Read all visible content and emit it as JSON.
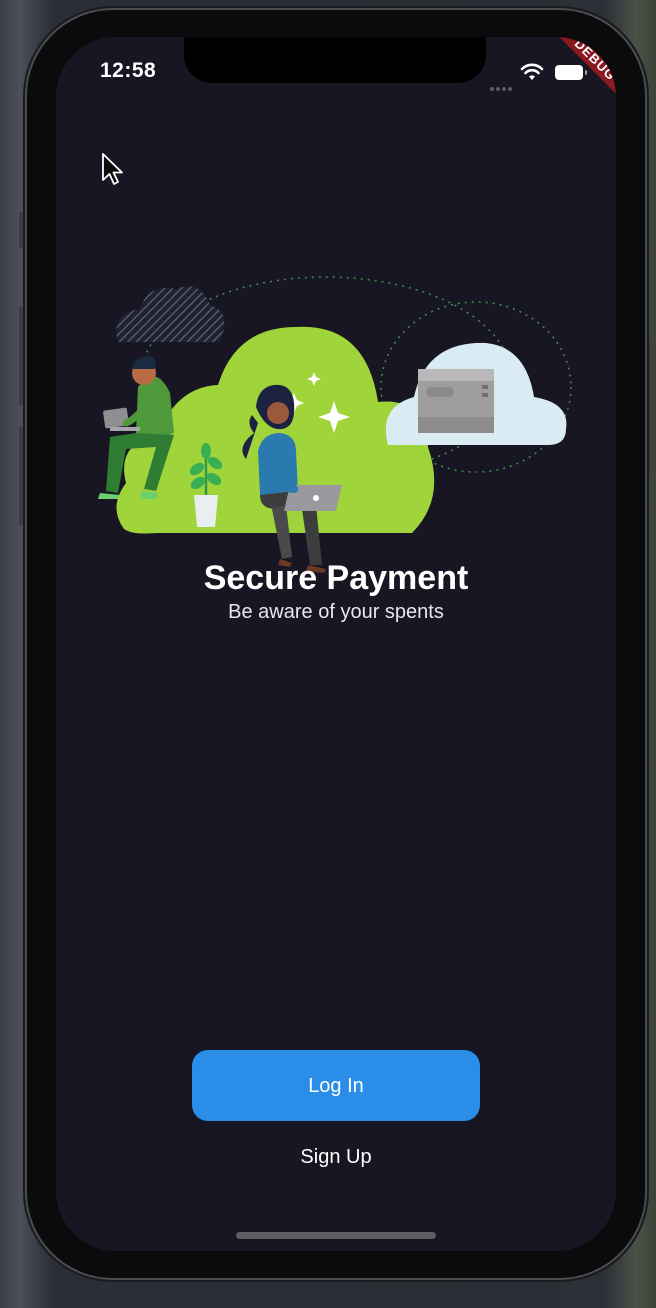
{
  "status_bar": {
    "time": "12:58",
    "debug_label": "DEBUG",
    "icons": [
      "cellular-signal-icon",
      "wifi-icon",
      "battery-icon"
    ]
  },
  "onboarding": {
    "title": "Secure Payment",
    "subtitle": "Be aware of your spents"
  },
  "actions": {
    "login_label": "Log In",
    "signup_label": "Sign Up"
  },
  "colors": {
    "background": "#171622",
    "primary_button": "#2a8ee8",
    "illustration_cloud": "#9fd43a",
    "debug_banner": "#8a1a1f"
  }
}
